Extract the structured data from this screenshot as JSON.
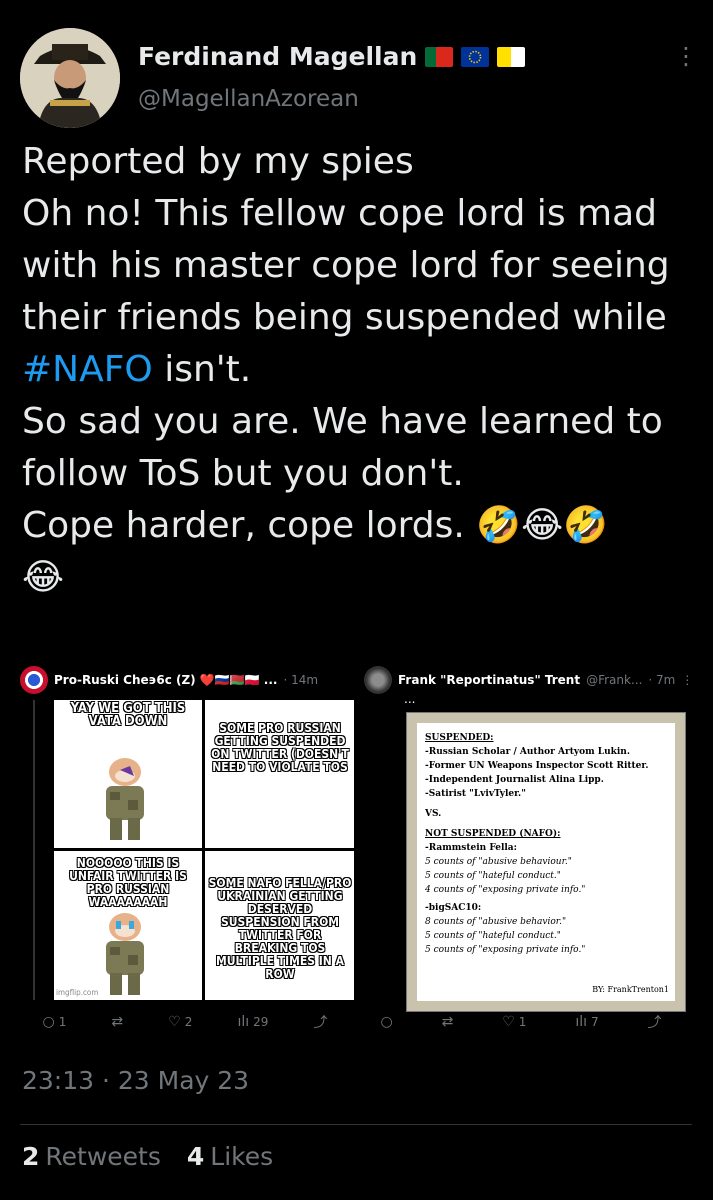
{
  "author": {
    "name": "Ferdinand Magellan",
    "handle": "@MagellanAzorean",
    "flags": [
      "portugal-flag",
      "eu-flag",
      "vatican-flag"
    ]
  },
  "tweet": {
    "text_before": "Reported by my spies\nOh no! This fellow cope lord is mad with his master cope lord for seeing their friends being suspended while ",
    "hashtag": "#NAFO",
    "text_after": " isn't.\nSo sad you are. We have learned to follow ToS but you don't.\nCope harder, cope lords. 🤣😂🤣\n😂"
  },
  "media": {
    "left": {
      "author": "Pro-Ruski Che϶6c (Z) ❤️🇷🇺🇧🇾🇵🇱 ...",
      "time": "· 14m",
      "meme": {
        "top_left": "YAY WE GOT THIS VATA DOWN",
        "top_right": "SOME PRO RUSSIAN GETTING SUSPENDED ON TWITTER (DOESN'T NEED TO VIOLATE TOS",
        "bottom_left": "NOOOOO THIS IS UNFAIR TWITTER IS PRO RUSSIAN WAAAAAAAH",
        "bottom_right": "SOME NAFO FELLA/PRO UKRAINIAN GETTING DESERVED SUSPENSION FROM TWITTER FOR BREAKING TOS MULTIPLE TIMES IN A ROW",
        "watermark": "imgflip.com"
      },
      "actions": {
        "replies": "1",
        "likes": "2",
        "views": "29"
      }
    },
    "right": {
      "author": "Frank \"Reportinatus\" Trent",
      "handle": "@Frank...",
      "time": "· 7m",
      "ellipsis": "...",
      "doc": {
        "suspended_title": "SUSPENDED:",
        "suspended": [
          "-Russian Scholar / Author Artyom Lukin.",
          "-Former UN Weapons Inspector Scott Ritter.",
          "-Independent Journalist Alina Lipp.",
          "-Satirist \"LvivTyler.\""
        ],
        "vs": "VS.",
        "not_suspended_title": "NOT SUSPENDED (NAFO):",
        "fella1": "-Rammstein Fella:",
        "fella1_counts": [
          "5 counts of \"abusive behaviour.\"",
          "5 counts of \"hateful conduct.\"",
          "4 counts of \"exposing private info.\""
        ],
        "fella2": "-bigSAC10:",
        "fella2_counts": [
          "8 counts of \"abusive behavior.\"",
          "5 counts of \"hateful conduct.\"",
          "5 counts of \"exposing private info.\""
        ],
        "by": "BY: FrankTrenton1"
      },
      "actions": {
        "likes": "1",
        "views": "7"
      }
    }
  },
  "timestamp": "23:13 · 23 May 23",
  "stats": {
    "retweets_count": "2",
    "retweets_label": "Retweets",
    "likes_count": "4",
    "likes_label": "Likes"
  }
}
